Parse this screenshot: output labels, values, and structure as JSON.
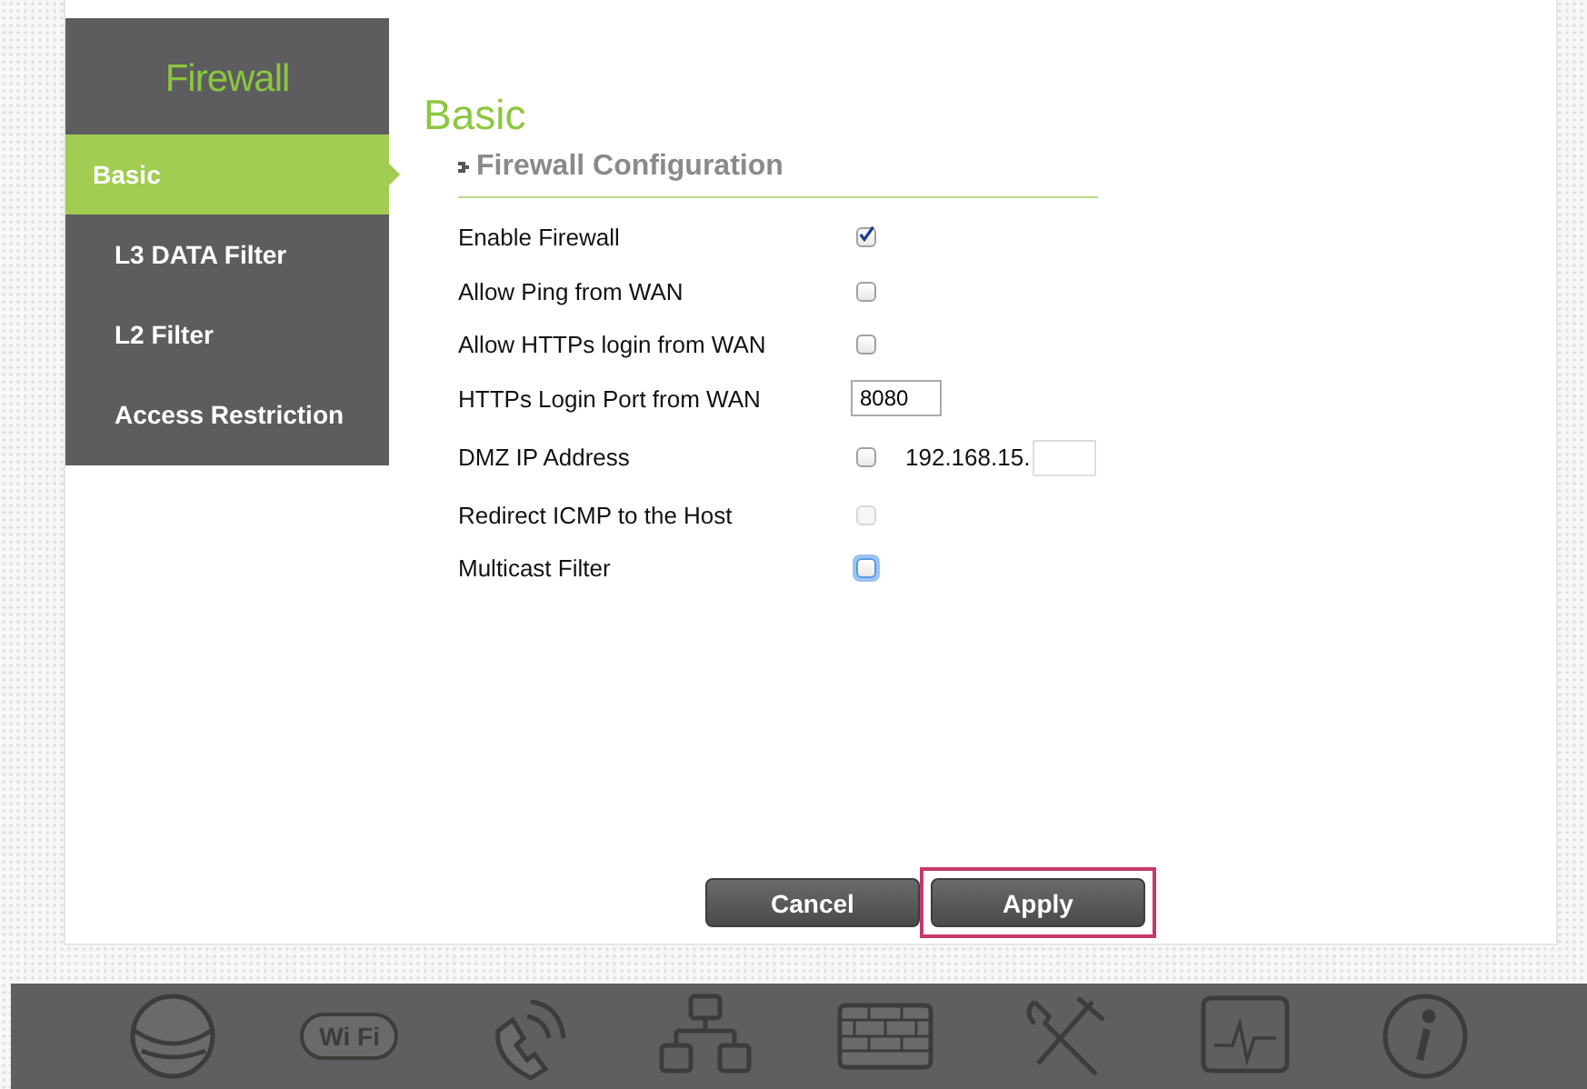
{
  "sidebar": {
    "title": "Firewall",
    "items": [
      {
        "label": "Basic",
        "selected": true
      },
      {
        "label": "L3 DATA Filter",
        "selected": false
      },
      {
        "label": "L2 Filter",
        "selected": false
      },
      {
        "label": "Access Restriction",
        "selected": false
      }
    ]
  },
  "page_title": "Basic",
  "section": {
    "title": "Firewall Configuration",
    "rows": [
      {
        "kind": "checkbox",
        "label": "Enable Firewall",
        "checked": true,
        "disabled": false,
        "focused": false
      },
      {
        "kind": "checkbox",
        "label": "Allow Ping from WAN",
        "checked": false,
        "disabled": false,
        "focused": false
      },
      {
        "kind": "checkbox",
        "label": "Allow HTTPs login from WAN",
        "checked": false,
        "disabled": false,
        "focused": false
      },
      {
        "kind": "text",
        "label": "HTTPs Login Port from WAN",
        "value": "8080"
      },
      {
        "kind": "ip",
        "label": "DMZ IP Address",
        "checked": false,
        "prefix": "192.168.15."
      },
      {
        "kind": "checkbox",
        "label": "Redirect ICMP to the Host",
        "checked": false,
        "disabled": true,
        "focused": false
      },
      {
        "kind": "checkbox",
        "label": "Multicast Filter",
        "checked": false,
        "disabled": false,
        "focused": true
      }
    ]
  },
  "buttons": [
    {
      "label": "Cancel",
      "highlighted": false
    },
    {
      "label": "Apply",
      "highlighted": true
    }
  ],
  "dock": [
    {
      "kind": "globe"
    },
    {
      "kind": "wifi",
      "text": "Wi Fi"
    },
    {
      "kind": "phone"
    },
    {
      "kind": "network"
    },
    {
      "kind": "wall"
    },
    {
      "kind": "tools"
    },
    {
      "kind": "monitor"
    },
    {
      "kind": "info"
    }
  ]
}
